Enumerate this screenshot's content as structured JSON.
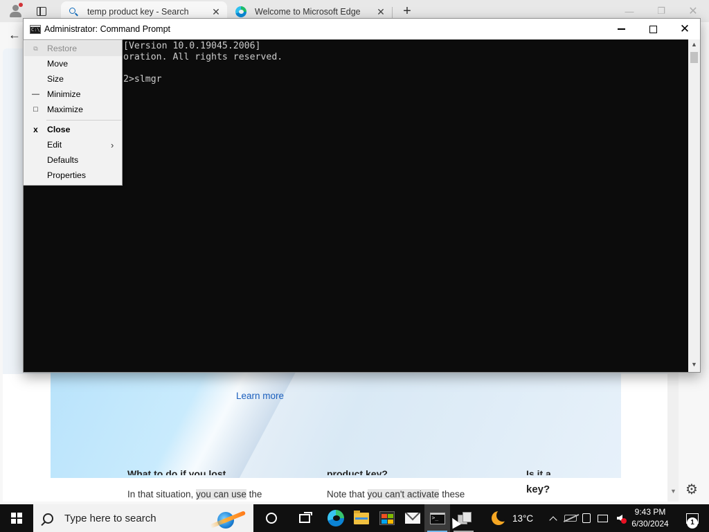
{
  "browser": {
    "tabs": [
      {
        "label": "temp product key - Search",
        "icon": "search-icon"
      },
      {
        "label": "Welcome to Microsoft Edge",
        "icon": "edge-icon"
      }
    ],
    "page": {
      "learn_more": "Learn more",
      "article1_text": "In that situation, ",
      "article1_highlight": "you can use",
      "article1_tail": " the",
      "article2_text": "Note that ",
      "article2_highlight": "you can't activate",
      "article2_tail": " these",
      "article3_heading_fragment": "key?",
      "cut1": "What to do if you lost",
      "cut2": "product key?",
      "cut3": "Is it a"
    }
  },
  "cmd": {
    "title": "Administrator: Command Prompt",
    "lines": [
      "[Version 10.0.19045.2006]",
      "oration. All rights reserved.",
      "2>slmgr"
    ]
  },
  "system_menu": {
    "items": [
      {
        "label": "Restore",
        "glyph": "⧉",
        "disabled": true
      },
      {
        "label": "Move"
      },
      {
        "label": "Size"
      },
      {
        "label": "Minimize",
        "glyph": "—"
      },
      {
        "label": "Maximize",
        "glyph": "□"
      },
      {
        "label": "Close",
        "glyph": "x",
        "bold": true
      },
      {
        "label": "Edit",
        "submenu": true
      },
      {
        "label": "Defaults"
      },
      {
        "label": "Properties"
      }
    ]
  },
  "taskbar": {
    "search_placeholder": "Type here to search",
    "apps": [
      "cortana-icon",
      "task-view-icon",
      "edge-icon",
      "file-explorer-icon",
      "store-icon",
      "mail-icon",
      "command-prompt-icon",
      "app-icon"
    ],
    "weather_temp": "13°C",
    "time": "9:43 PM",
    "date": "6/30/2024",
    "notification_count": "1"
  },
  "colors": {
    "console_bg": "#0c0c0c",
    "console_text": "#cccccc",
    "taskbar_bg": "#101010",
    "link": "#1b5fbd"
  }
}
